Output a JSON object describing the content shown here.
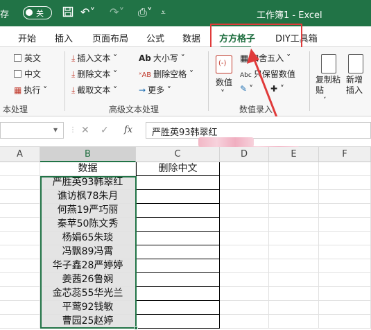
{
  "titlebar": {
    "autosave_label": "存",
    "toggle_label": "关",
    "window_title": "工作簿1  -  Excel",
    "colors": {
      "bar": "#217346"
    }
  },
  "tabs": [
    {
      "label": "开始"
    },
    {
      "label": "插入"
    },
    {
      "label": "页面布局"
    },
    {
      "label": "公式"
    },
    {
      "label": "数据"
    },
    {
      "label": "方方格子",
      "active": true
    },
    {
      "label": "DIY工具箱"
    }
  ],
  "ribbon": {
    "group1": {
      "items": [
        "英文",
        "中文",
        "执行"
      ],
      "label": "本处理"
    },
    "group2": {
      "items": [
        "插入文本",
        "删除文本",
        "截取文本",
        "大小写",
        "删除空格",
        "更多"
      ],
      "label": "高级文本处理"
    },
    "group3": {
      "items": [
        "四舍五入",
        "只保留数值",
        "数值"
      ],
      "label": "数值录入"
    },
    "group4": {
      "items": [
        "复制粘贴",
        "新增插入"
      ]
    }
  },
  "formula_bar": {
    "fx": "fx",
    "content": "严胜英93韩翠红"
  },
  "grid": {
    "columns": [
      "A",
      "B",
      "C",
      "D",
      "E",
      "F"
    ],
    "header_row": {
      "B": "数据",
      "C": "删除中文"
    },
    "rows": [
      "严胜英93韩翠红",
      "谯访枫78朱月",
      "何燕19严巧丽",
      "秦苹50陈文秀",
      "杨娟65朱琰",
      "冯飘89冯霄",
      "华子鑫28严婷婷",
      "姜茜26鲁娴",
      "金芯蕊55华光兰",
      "平莺92钱敏",
      "曹园25赵婷"
    ]
  }
}
